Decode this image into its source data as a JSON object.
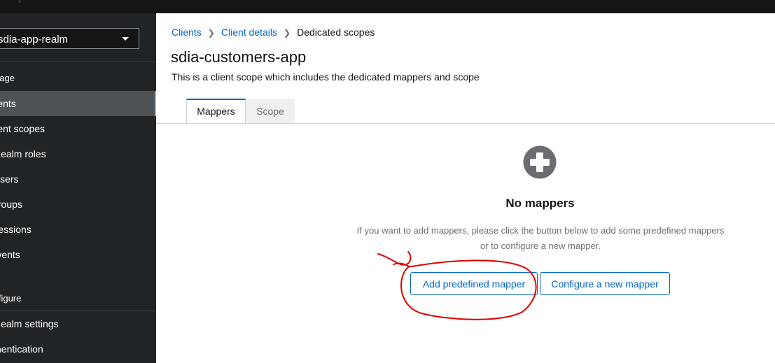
{
  "sidebar": {
    "realm": "sdia-app-realm",
    "sections": {
      "manage": "Manage",
      "configure": "Configure"
    },
    "items": [
      {
        "label": "Clients",
        "active": true
      },
      {
        "label": "Client scopes"
      },
      {
        "label": "Realm roles"
      },
      {
        "label": "Users"
      },
      {
        "label": "Groups"
      },
      {
        "label": "Sessions"
      },
      {
        "label": "Events"
      },
      {
        "label": "Realm settings"
      },
      {
        "label": "Authentication"
      }
    ]
  },
  "breadcrumb": [
    "Clients",
    "Client details",
    "Dedicated scopes"
  ],
  "page": {
    "title": "sdia-customers-app",
    "description": "This is a client scope which includes the dedicated mappers and scope"
  },
  "tabs": [
    {
      "label": "Mappers",
      "active": true
    },
    {
      "label": "Scope",
      "active": false
    }
  ],
  "empty_state": {
    "icon": "plus-circle-icon",
    "title": "No mappers",
    "body": "If you want to add mappers, please click the button below to add some predefined mappers or to configure a new mapper.",
    "add_button": "Add predefined mapper",
    "configure_button": "Configure a new mapper"
  },
  "colors": {
    "link": "#0066cc",
    "sidebar_bg": "#212427",
    "annotation": "#e00000"
  }
}
